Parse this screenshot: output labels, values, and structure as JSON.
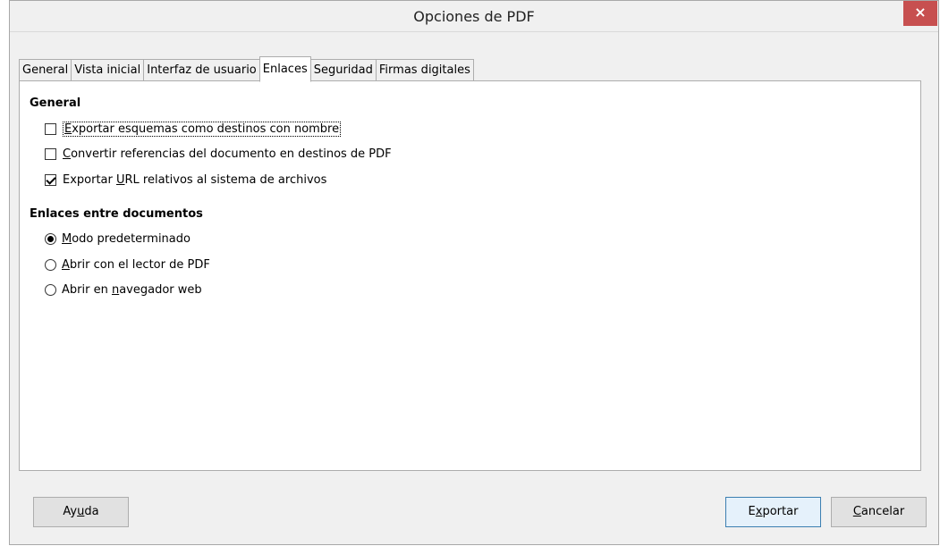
{
  "window": {
    "title": "Opciones de PDF",
    "close_label": "×"
  },
  "tabs": [
    {
      "label": "General",
      "active": false
    },
    {
      "label": "Vista inicial",
      "active": false
    },
    {
      "label": "Interfaz de usuario",
      "active": false
    },
    {
      "label": "Enlaces",
      "active": true
    },
    {
      "label": "Seguridad",
      "active": false
    },
    {
      "label": "Firmas digitales",
      "active": false
    }
  ],
  "general_section": {
    "title": "General",
    "options": [
      {
        "pre": "",
        "mnemonic": "E",
        "post": "xportar esquemas como destinos con nombre",
        "checked": false
      },
      {
        "pre": "",
        "mnemonic": "C",
        "post": "onvertir referencias del documento en destinos de PDF",
        "checked": false
      },
      {
        "pre": "Exportar ",
        "mnemonic": "U",
        "post": "RL relativos al sistema de archivos",
        "checked": true
      }
    ]
  },
  "cross_doc_section": {
    "title": "Enlaces entre documentos",
    "options": [
      {
        "pre": "",
        "mnemonic": "M",
        "post": "odo predeterminado",
        "selected": true
      },
      {
        "pre": "",
        "mnemonic": "A",
        "post": "brir con el lector de PDF",
        "selected": false
      },
      {
        "pre": "Abrir en ",
        "mnemonic": "n",
        "post": "avegador web",
        "selected": false
      }
    ]
  },
  "buttons": {
    "help": {
      "pre": "Ay",
      "mnemonic": "u",
      "post": "da"
    },
    "export": {
      "pre": "E",
      "mnemonic": "x",
      "post": "portar"
    },
    "cancel": {
      "pre": "",
      "mnemonic": "C",
      "post": "ancelar"
    }
  }
}
